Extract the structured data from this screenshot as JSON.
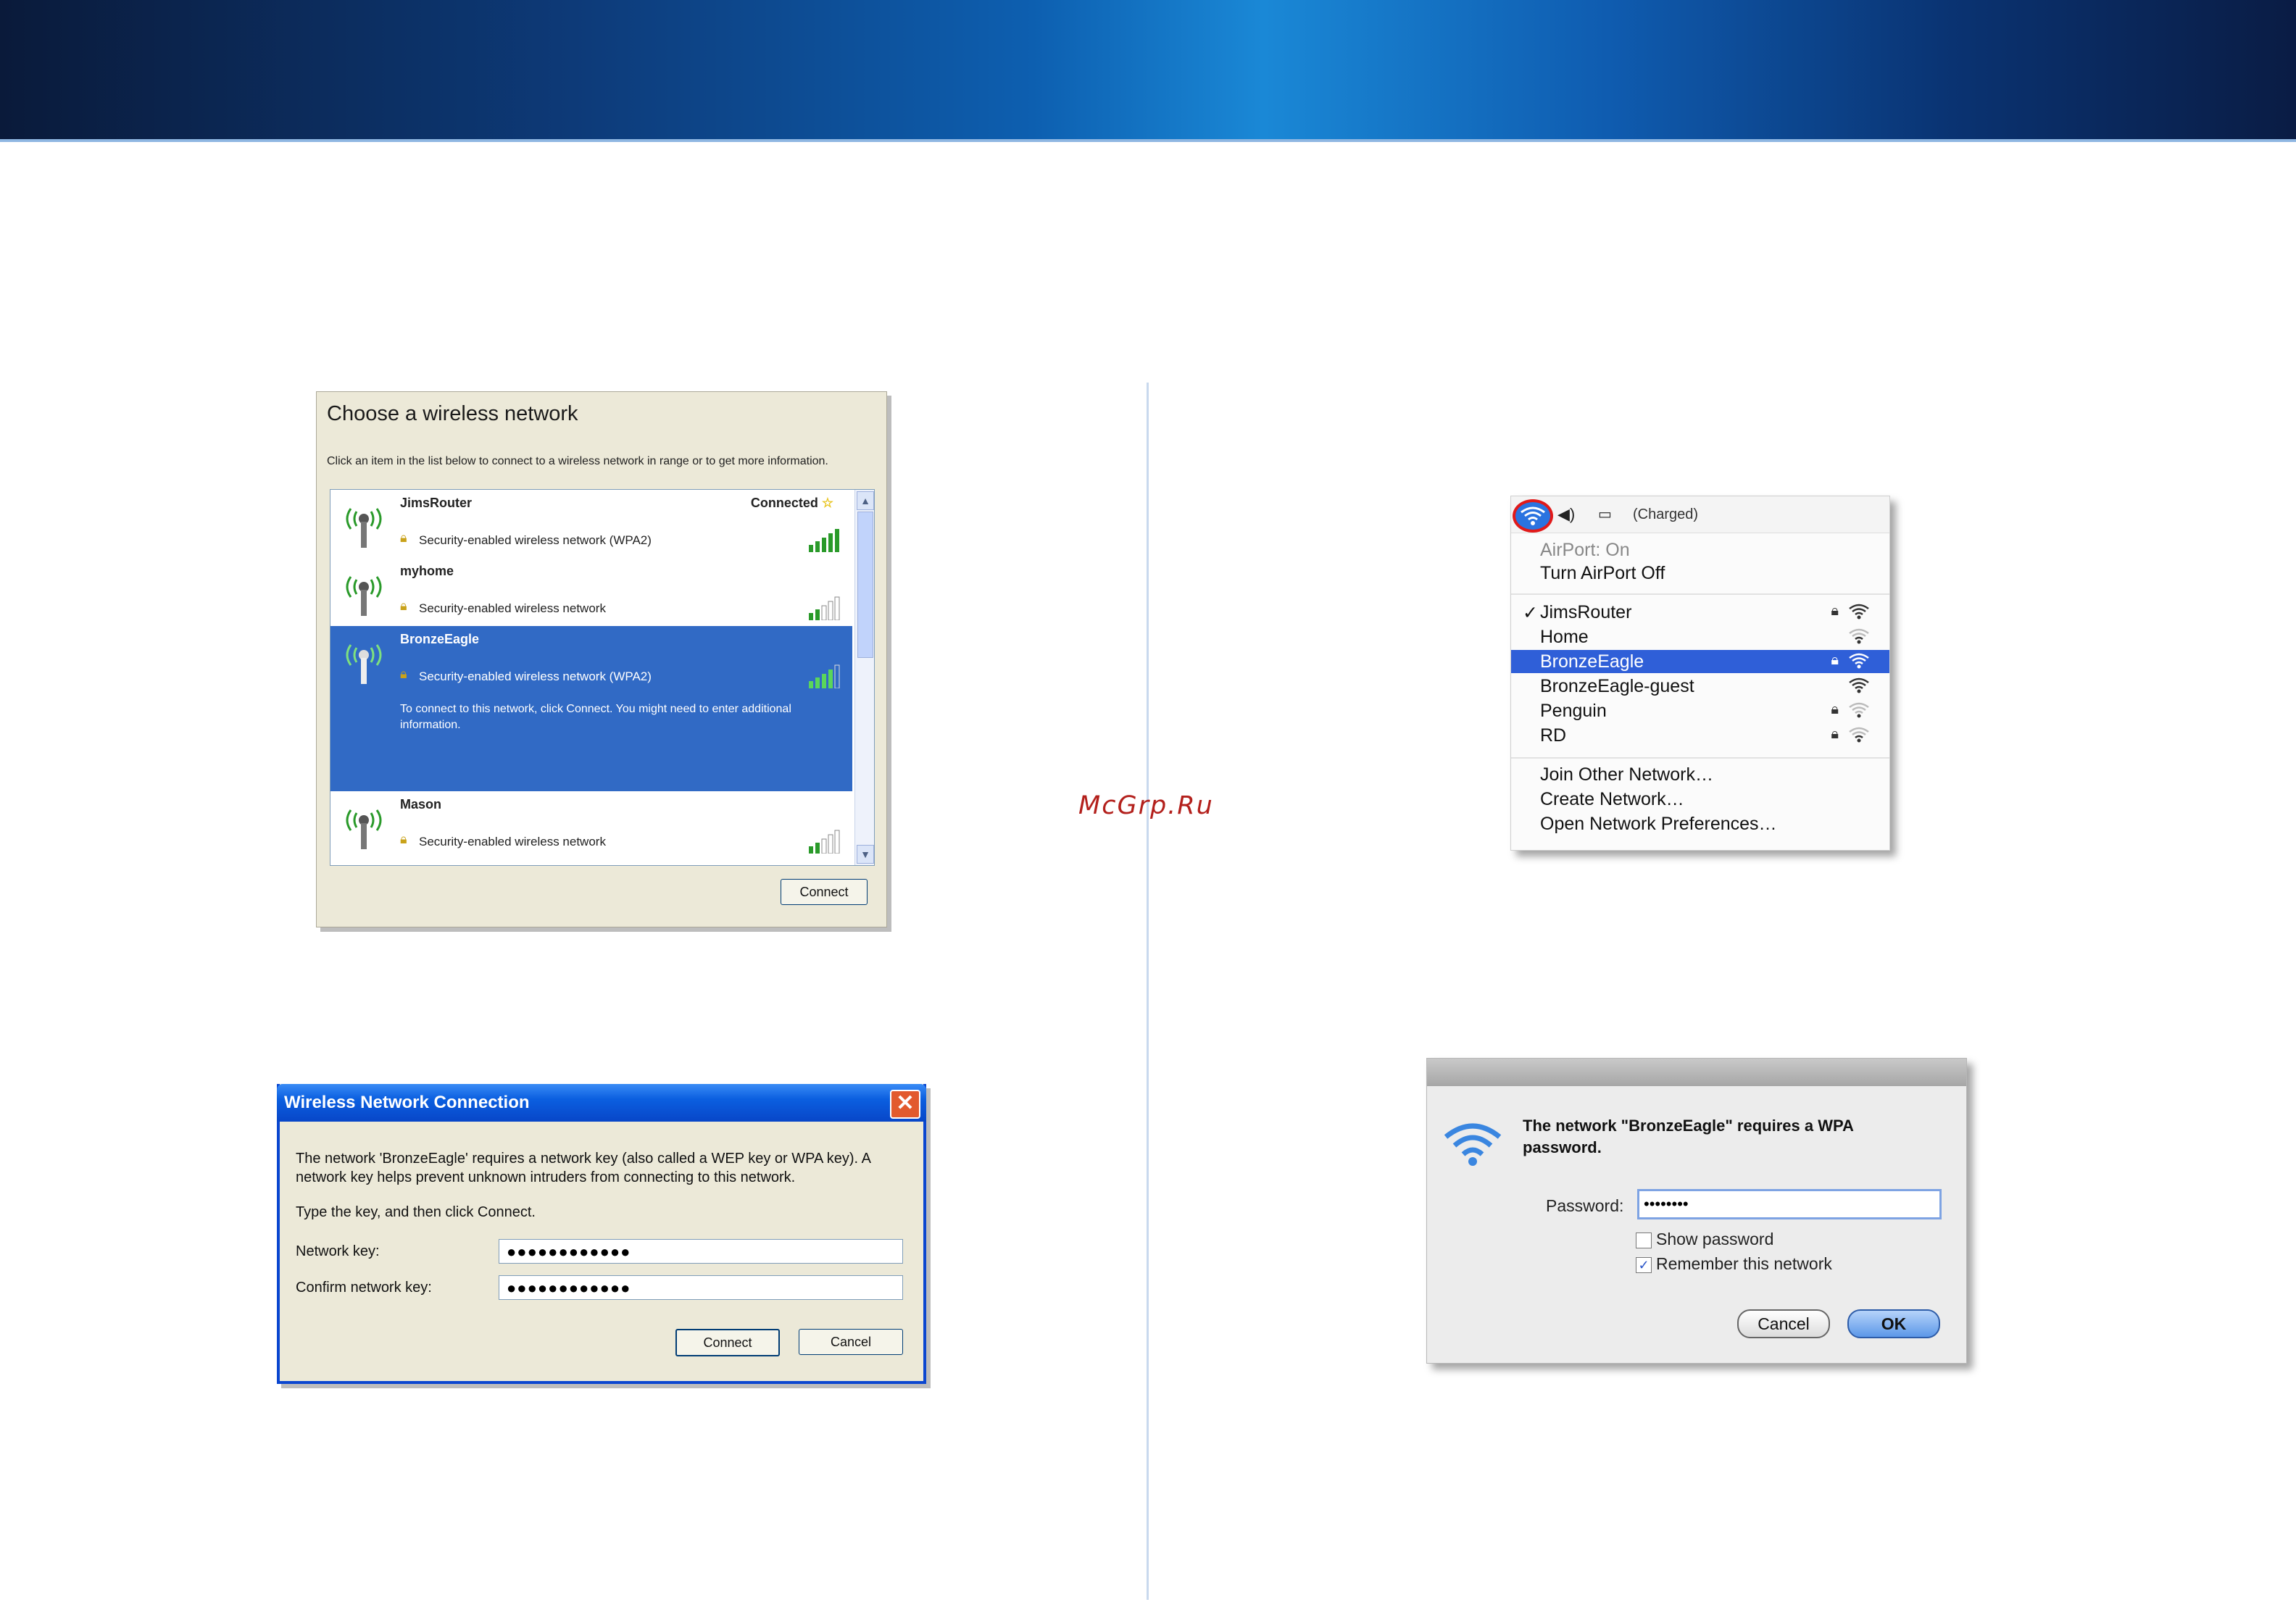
{
  "watermark": "McGrp.Ru",
  "xp_choose": {
    "title": "Choose a wireless network",
    "description": "Click an item in the list below to connect to a wireless network in range or to get more information.",
    "networks": [
      {
        "name": "JimsRouter",
        "status": "Connected",
        "security": "Security-enabled wireless network (WPA2)",
        "signal": 5
      },
      {
        "name": "myhome",
        "status": "",
        "security": "Security-enabled wireless network",
        "signal": 2
      },
      {
        "name": "BronzeEagle",
        "status": "",
        "security": "Security-enabled wireless network (WPA2)",
        "signal": 3,
        "info": "To connect to this network, click Connect. You might need to enter additional information."
      },
      {
        "name": "Mason",
        "status": "",
        "security": "Security-enabled wireless network",
        "signal": 2
      }
    ],
    "connect_label": "Connect"
  },
  "xp_key": {
    "title": "Wireless Network Connection",
    "message": "The network 'BronzeEagle' requires a network key (also called a WEP key or WPA key). A network key helps prevent unknown intruders from connecting to this network.",
    "instruction": "Type the key, and then click Connect.",
    "network_key_label": "Network key:",
    "network_key_value": "●●●●●●●●●●●●",
    "confirm_key_label": "Confirm network key:",
    "confirm_key_value": "●●●●●●●●●●●●",
    "connect_label": "Connect",
    "cancel_label": "Cancel"
  },
  "mac_menu": {
    "battery_status": "(Charged)",
    "airport_status": "AirPort: On",
    "turn_off": "Turn AirPort Off",
    "networks": [
      {
        "name": "JimsRouter",
        "checked": true,
        "locked": true
      },
      {
        "name": "Home",
        "checked": false,
        "locked": false
      },
      {
        "name": "BronzeEagle",
        "checked": false,
        "locked": true,
        "highlighted": true
      },
      {
        "name": "BronzeEagle-guest",
        "checked": false,
        "locked": false
      },
      {
        "name": "Penguin",
        "checked": false,
        "locked": true
      },
      {
        "name": "RD",
        "checked": false,
        "locked": true
      }
    ],
    "join_other": "Join Other Network…",
    "create_network": "Create Network…",
    "open_prefs": "Open Network Preferences…"
  },
  "mac_password": {
    "message": "The network \"BronzeEagle\" requires a WPA password.",
    "password_label": "Password:",
    "password_value": "••••••••",
    "show_password": "Show password",
    "remember": "Remember this network",
    "cancel_label": "Cancel",
    "ok_label": "OK"
  }
}
